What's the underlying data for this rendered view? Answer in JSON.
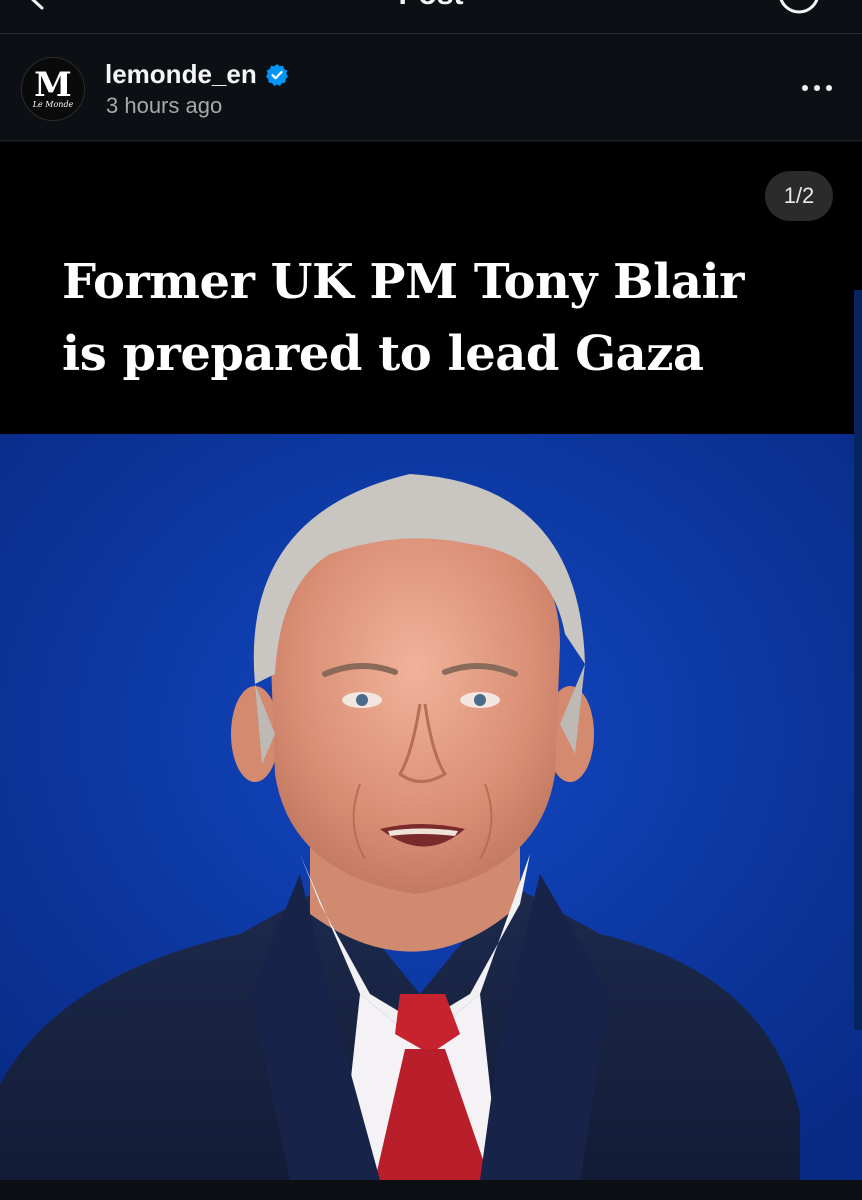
{
  "topbar": {
    "title": "Post",
    "back_icon": "chevron-left-icon",
    "right_icon": "circle-icon"
  },
  "post": {
    "username": "lemonde_en",
    "timestamp": "3 hours ago",
    "avatar": {
      "monogram": "M",
      "wordmark": "Le Monde"
    },
    "verified_icon": "verified-badge-icon",
    "more_icon": "more-options-icon",
    "carousel_counter": "1/2",
    "headline_line1": "Former UK PM Tony Blair",
    "headline_line2": "is prepared to lead Gaza",
    "photo": {
      "subject": "portrait-photo",
      "background_color": "#0b3aa6"
    }
  },
  "colors": {
    "background": "#0c1014",
    "verified": "#0095f6",
    "secondary_text": "#a8a8a8"
  }
}
